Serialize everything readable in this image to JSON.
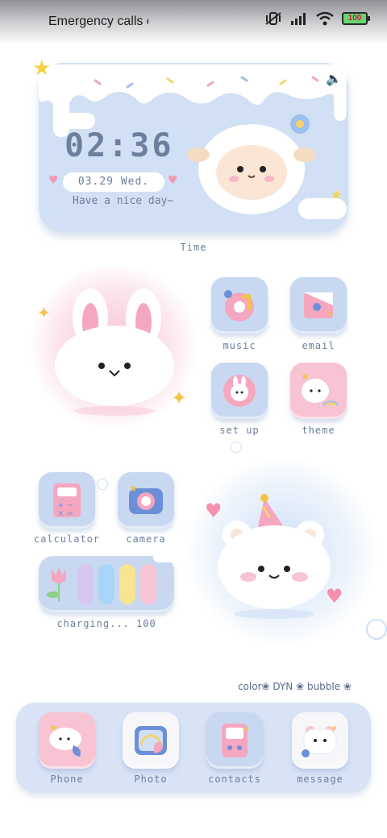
{
  "status_bar": {
    "carrier_text": "Emergency calls o",
    "battery": "100"
  },
  "clock_widget": {
    "time": "02:36",
    "date": "03.29  Wed.",
    "greeting": "Have a nice day~",
    "label": "Time"
  },
  "apps": {
    "music": "music",
    "email": "email",
    "setup": "set up",
    "theme": "theme",
    "calculator": "calculator",
    "camera": "camera"
  },
  "charging": {
    "label": "charging... 100"
  },
  "watermark": {
    "text": "color❀ DYN ❀ bubble ❀"
  },
  "dock": {
    "phone": "Phone",
    "photo": "Photo",
    "contacts": "contacts",
    "message": "message"
  },
  "colors": {
    "accent_blue": "#c9d8f1",
    "accent_pink": "#f8c3d3",
    "text": "#6c7f9c"
  }
}
